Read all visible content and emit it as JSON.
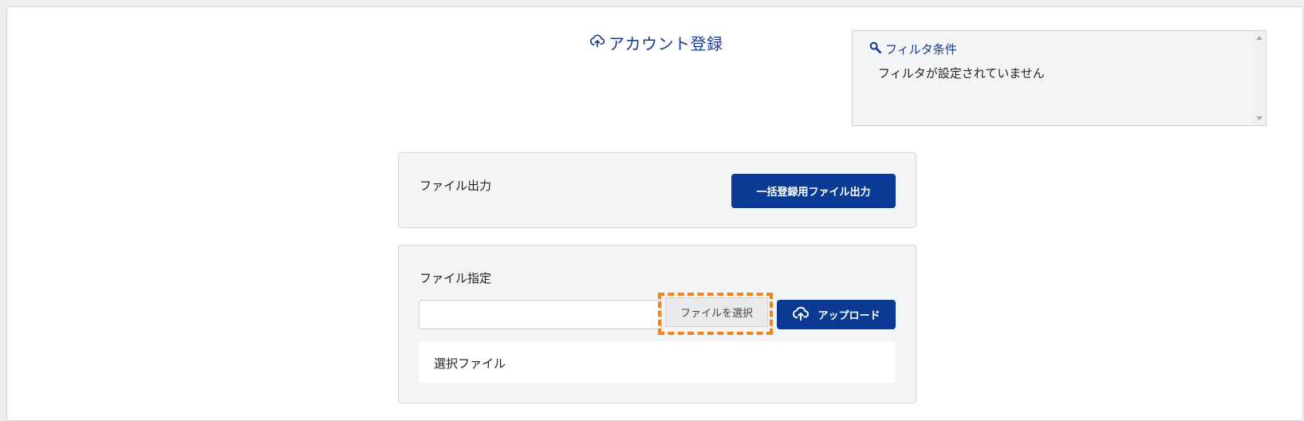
{
  "page": {
    "title": "アカウント登録",
    "title_icon": "cloud-upload-icon"
  },
  "filter": {
    "heading": "フィルタ条件",
    "heading_icon": "search-icon",
    "text": "フィルタが設定されていません"
  },
  "export_card": {
    "label": "ファイル出力",
    "button_label": "一括登録用ファイル出力"
  },
  "upload_card": {
    "label": "ファイル指定",
    "choose_label": "ファイルを選択",
    "upload_label": "アップロード",
    "upload_icon": "cloud-upload-icon",
    "selected_label": "選択ファイル"
  },
  "colors": {
    "primary": "#0a3a94",
    "title": "#1a3a8f",
    "highlight": "#f0861b",
    "panel": "#f3f4f5"
  }
}
